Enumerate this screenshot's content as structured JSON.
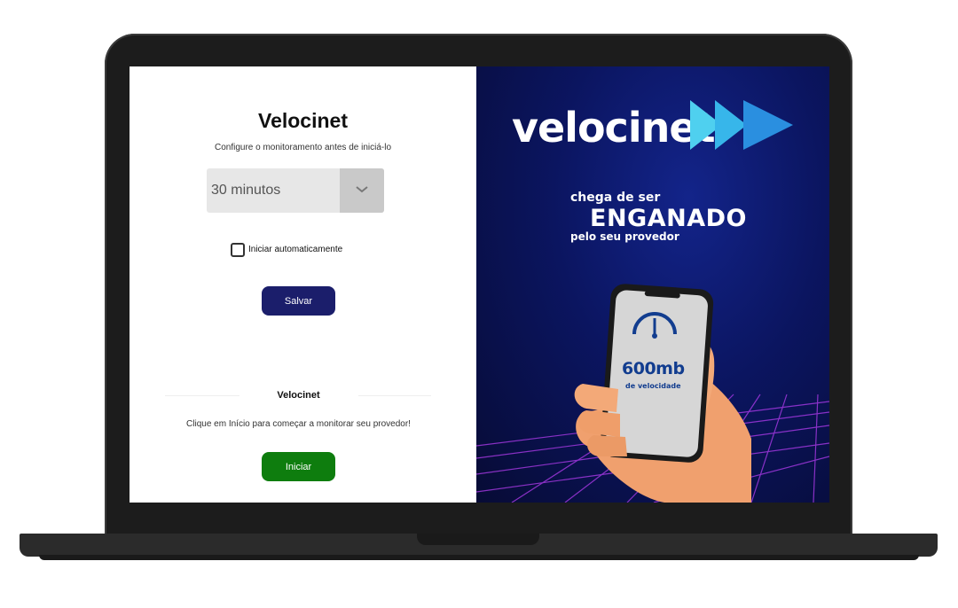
{
  "app": {
    "title": "Velocinet",
    "subtitle": "Configure o monitoramento antes de iniciá-lo"
  },
  "interval_select": {
    "value": "30 minutos",
    "icon": "chevron-down-icon"
  },
  "auto_start": {
    "label": "Iniciar automaticamente",
    "checked": false
  },
  "save_button": {
    "label": "Salvar",
    "color": "#1b1e6b"
  },
  "section": {
    "title": "Velocinet",
    "text": "Clique em Início para começar a monitorar seu provedor!"
  },
  "start_button": {
    "label": "Iniciar",
    "color": "#0e7d0e"
  },
  "promo": {
    "brand": "velocinet",
    "line1": "chega de ser",
    "line2": "ENGANADO",
    "line3": "pelo seu provedor",
    "speed_value": "600mb",
    "speed_caption": "de velocidade"
  }
}
